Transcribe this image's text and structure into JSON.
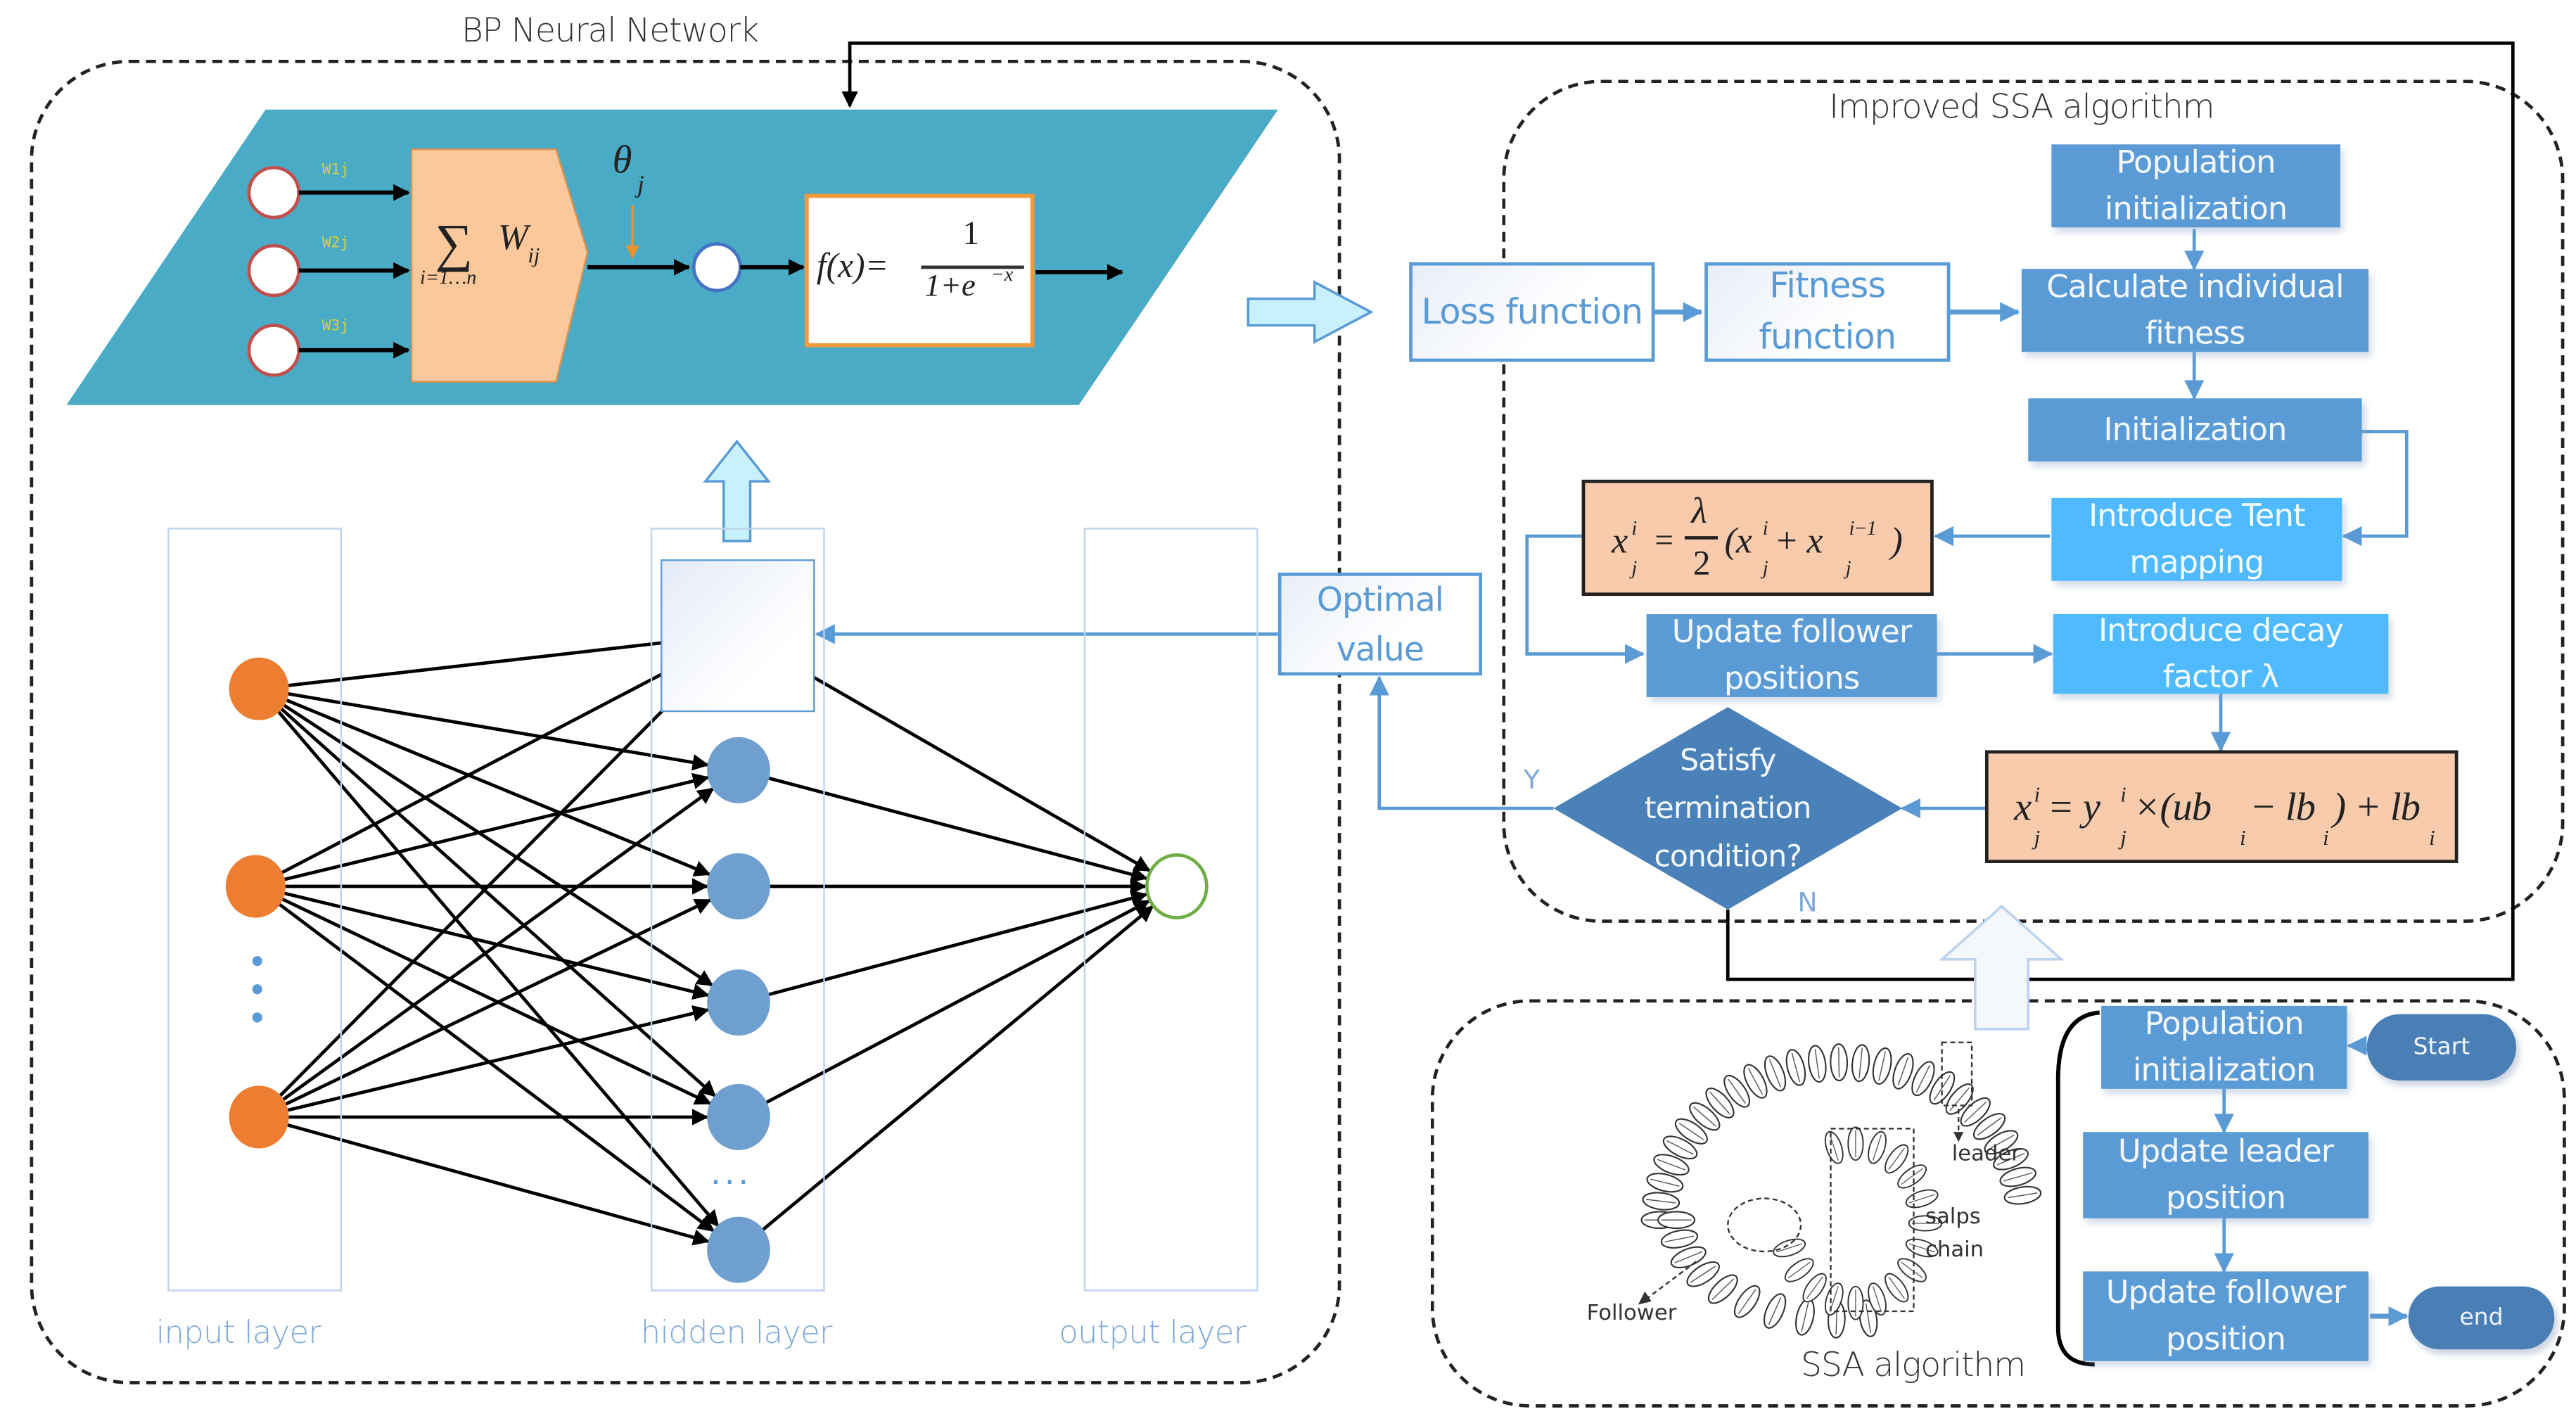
{
  "groups": {
    "bp": {
      "title": "BP Neural Network"
    },
    "improved": {
      "title": "Improved SSA algorithm"
    },
    "ssa": {
      "title": "SSA algorithm"
    }
  },
  "neuron_model": {
    "inputs": [
      "W1j",
      "W2j",
      "W3j"
    ],
    "summation": {
      "symbol": "∑",
      "weight": "W",
      "weight_sub": "ij",
      "index": "i=1…n"
    },
    "bias": {
      "symbol": "θ",
      "sub": "j"
    },
    "activation": {
      "lhs": "f(x)=",
      "numerator": "1",
      "denominator": "1+e",
      "exponent": "−x"
    }
  },
  "network": {
    "layers": [
      {
        "label": "input layer",
        "nodes": 3,
        "ellipsis": "⋮"
      },
      {
        "label": "hidden layer",
        "nodes": 6,
        "ellipsis": "···"
      },
      {
        "label": "output layer",
        "nodes": 1
      }
    ],
    "colors": {
      "input": "#ed7d31",
      "hidden": "#6f9fcf",
      "output_ring": "#70ad47"
    }
  },
  "improved_ssa": {
    "loss_function": "Loss function",
    "fitness_function": "Fitness\nfunction",
    "population_init": "Population\ninitialization",
    "calc_fitness": "Calculate individual\nfitness",
    "initialization": "Initialization",
    "tent_mapping": "Introduce Tent\nmapping",
    "update_follower": "Update follower\npositions",
    "decay_factor": "Introduce decay\nfactor λ",
    "decision": "Satisfy\ntermination\ncondition?",
    "yes": "Y",
    "no": "N",
    "optimal_value": "Optimal\nvalue",
    "formula_follower": {
      "lhs": "x",
      "lhs_sup": "i",
      "lhs_sub": "j",
      "eq": "=",
      "frac_num": "λ",
      "frac_den": "2",
      "rhs": "(x",
      "rhs_sup1": "i",
      "rhs_sub1": "j",
      "plus": " + x",
      "rhs_sup2": "i−1",
      "rhs_sub2": "j",
      "close": ")"
    },
    "formula_tent": {
      "text": "x",
      "sup": "i",
      "sub": "j",
      "rest1": " = y",
      "sup2": "i",
      "sub2": "j",
      "rest2": " ×(ub",
      "sub3": "i",
      "rest3": " − lb",
      "sub4": "i",
      "rest4": ") + lb",
      "sub5": "i"
    }
  },
  "ssa": {
    "start": "Start",
    "end": "end",
    "population_init": "Population\ninitialization",
    "update_leader": "Update leader\nposition",
    "update_follower": "Update follower\nposition",
    "salp_labels": {
      "leader": "leader",
      "chain": "salps\nchain",
      "follower": "Follower"
    }
  },
  "colors": {
    "mid_blue": "#5b9bd5",
    "light_blue": "#4fbaff",
    "dark_blue": "#4a7fb5",
    "formula_fill": "#f8cbad",
    "teal": "#4aabc6",
    "sum_fill": "#fbc89b"
  }
}
